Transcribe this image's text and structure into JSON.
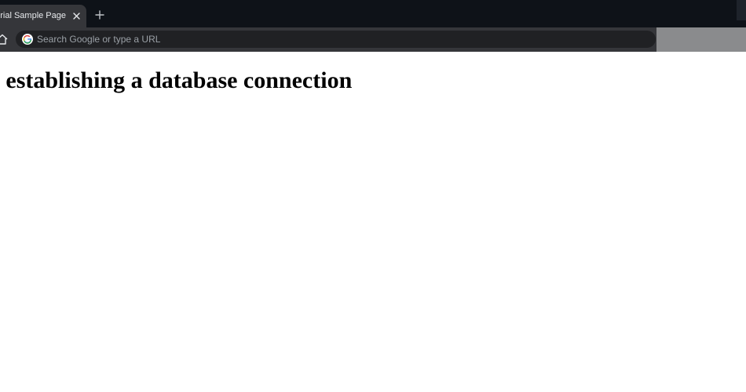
{
  "tab": {
    "title": "Tutorial Sample Page",
    "close_glyph": "×",
    "new_tab_glyph": "+"
  },
  "toolbar": {
    "home_icon": "home-icon",
    "omnibox": {
      "placeholder": "Search Google or type a URL",
      "value": ""
    }
  },
  "page": {
    "heading": "Error establishing a database connection"
  },
  "colors": {
    "tabstrip_bg": "#0e1218",
    "active_tab_bg": "#35363a",
    "omnibox_bg": "#202124",
    "page_bg": "#ffffff"
  }
}
